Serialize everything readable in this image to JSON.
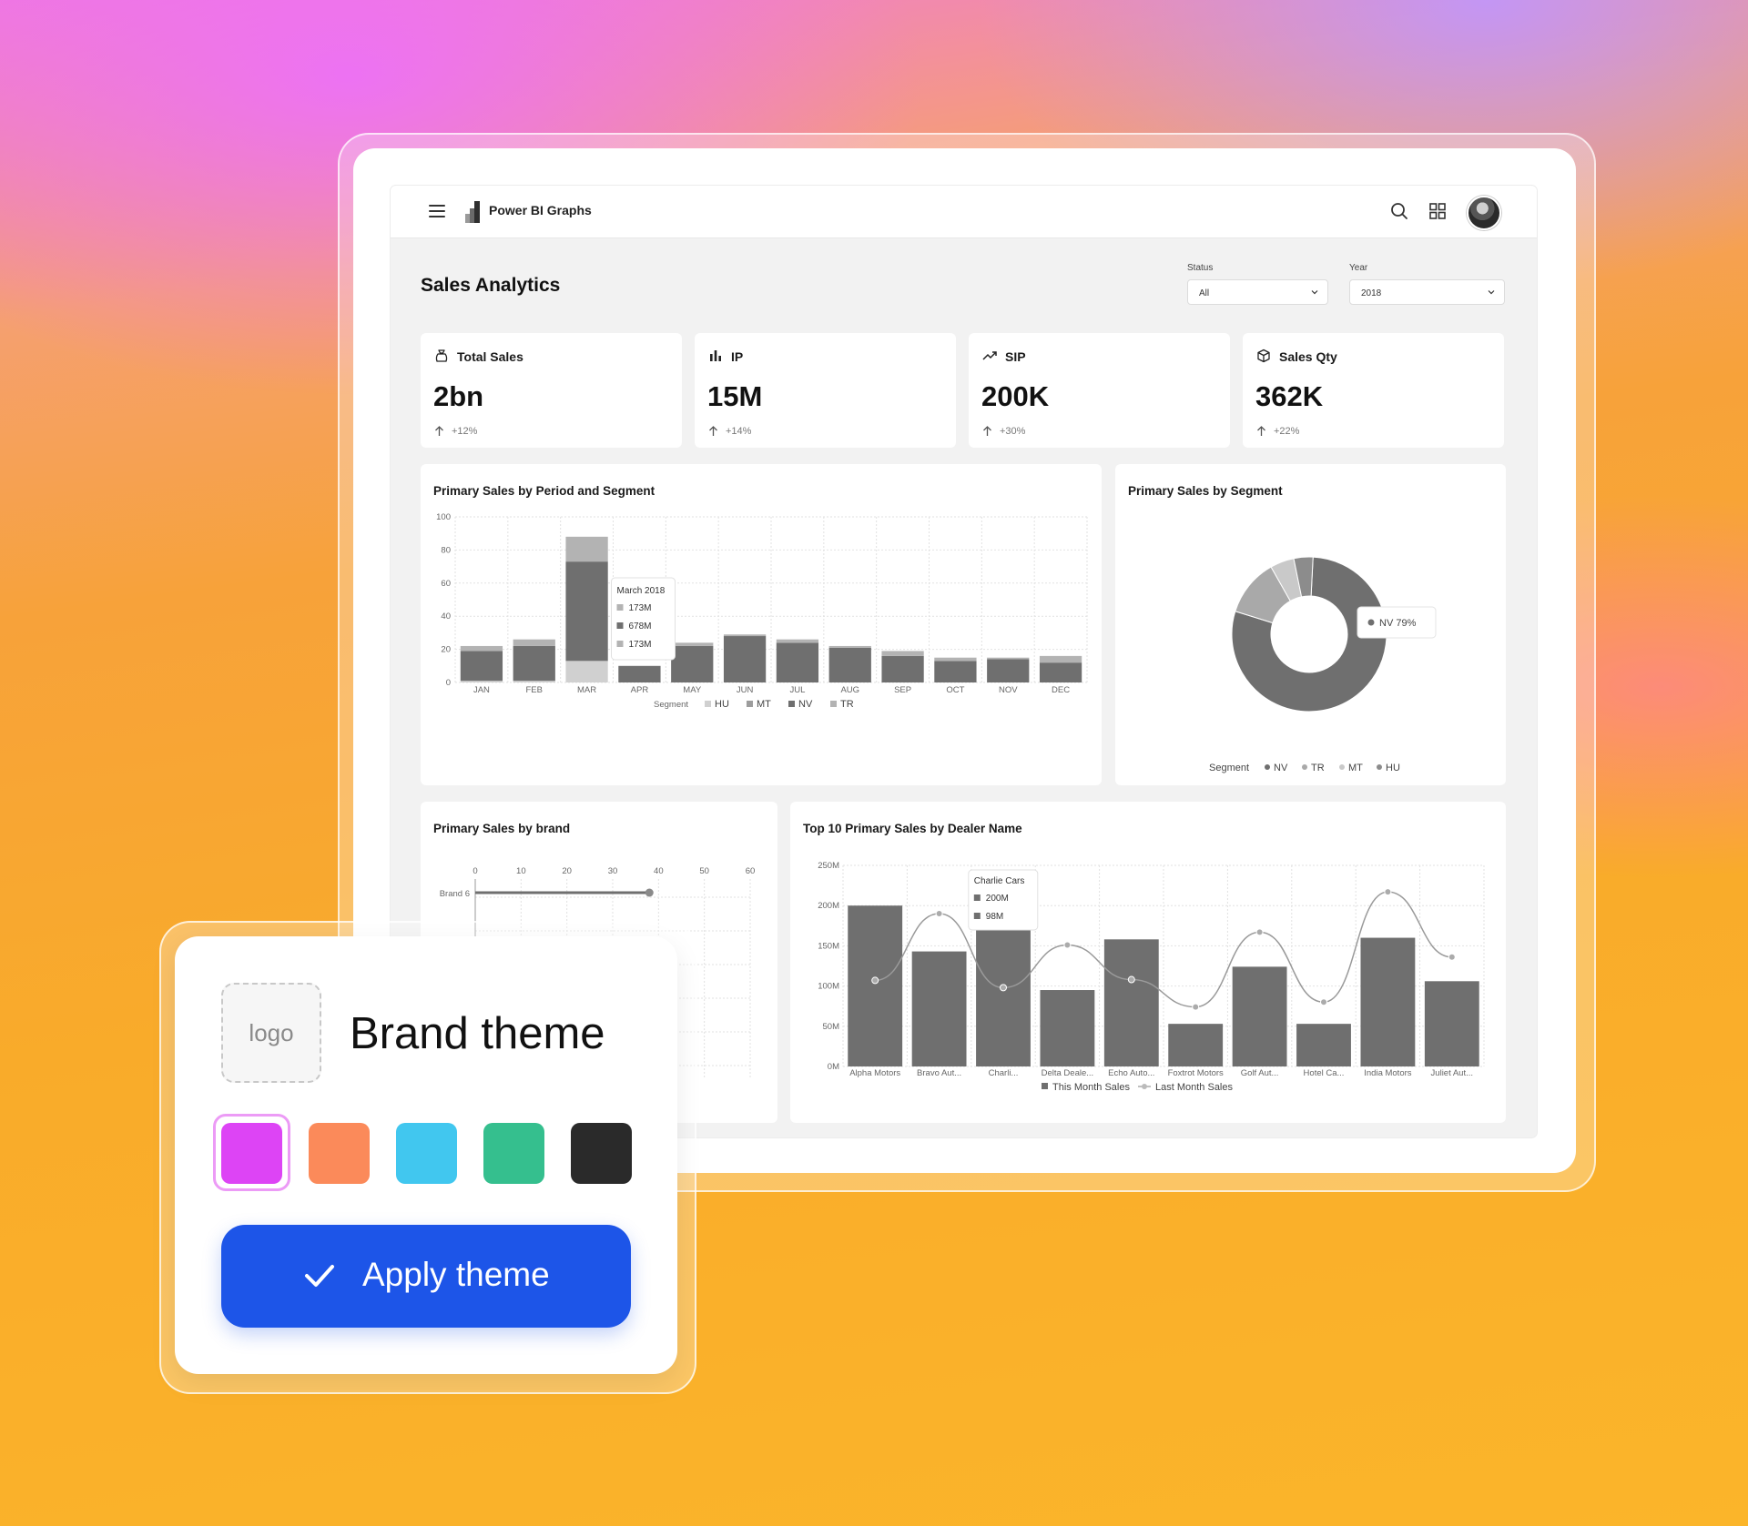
{
  "app": {
    "name": "Power BI Graphs",
    "page_title": "Sales Analytics"
  },
  "filters": {
    "status_label": "Status",
    "status_value": "All",
    "year_label": "Year",
    "year_value": "2018"
  },
  "kpis": [
    {
      "title": "Total Sales",
      "value": "2bn",
      "delta": "+12%",
      "icon": "money-bag-icon"
    },
    {
      "title": "IP",
      "value": "15M",
      "delta": "+14%",
      "icon": "bar-chart-icon"
    },
    {
      "title": "SIP",
      "value": "200K",
      "delta": "+30%",
      "icon": "trend-line-icon"
    },
    {
      "title": "Sales Qty",
      "value": "362K",
      "delta": "+22%",
      "icon": "package-icon"
    }
  ],
  "charts": {
    "period_title": "Primary Sales by Period and Segment",
    "segment_title": "Primary Sales by Segment",
    "brand_title": "Primary Sales by brand",
    "dealer_title": "Top 10 Primary Sales by Dealer Name"
  },
  "chart_data": [
    {
      "type": "bar",
      "stacked": true,
      "title": "Primary Sales by Period and Segment",
      "categories": [
        "JAN",
        "FEB",
        "MAR",
        "APR",
        "MAY",
        "JUN",
        "JUL",
        "AUG",
        "SEP",
        "OCT",
        "NOV",
        "DEC"
      ],
      "ylim": [
        0,
        100
      ],
      "yticks": [
        0,
        20,
        40,
        60,
        80,
        100
      ],
      "legend_title": "Segment",
      "series": [
        {
          "name": "HU",
          "values": [
            1,
            1,
            13,
            0,
            0,
            0,
            0,
            0,
            0,
            0,
            0,
            0
          ]
        },
        {
          "name": "MT",
          "values": [
            0,
            0,
            0,
            0,
            0,
            0,
            0,
            0,
            0,
            0,
            0,
            0
          ]
        },
        {
          "name": "NV",
          "values": [
            18,
            21,
            60,
            10,
            22,
            28,
            24,
            21,
            16,
            13,
            14,
            12
          ]
        },
        {
          "name": "TR",
          "values": [
            3,
            4,
            15,
            0,
            2,
            1,
            2,
            1,
            3,
            2,
            1,
            4
          ]
        }
      ],
      "tooltip": {
        "title": "March 2018",
        "lines": [
          "173M",
          "678M",
          "173M"
        ]
      },
      "grid": true,
      "legend_position": "bottom"
    },
    {
      "type": "pie",
      "donut": true,
      "title": "Primary Sales by Segment",
      "legend_title": "Segment",
      "categories": [
        "NV",
        "TR",
        "MT",
        "HU"
      ],
      "values": [
        79,
        12,
        5,
        4
      ],
      "tooltip": "NV 79%",
      "legend_position": "bottom"
    },
    {
      "type": "bar",
      "orientation": "horizontal",
      "title": "Primary Sales by brand",
      "xticks": [
        0,
        10,
        20,
        30,
        40,
        50,
        60
      ],
      "categories": [
        "Brand 6"
      ],
      "values": [
        38
      ],
      "grid": true
    },
    {
      "type": "bar",
      "title": "Top 10 Primary Sales by Dealer Name",
      "categories": [
        "Alpha Motors",
        "Bravo Aut...",
        "Charli...",
        "Delta Deale...",
        "Echo Auto...",
        "Foxtrot Motors",
        "Golf Aut...",
        "Hotel Ca...",
        "India Motors",
        "Juliet Aut..."
      ],
      "ylim": [
        0,
        250
      ],
      "yticks": [
        "0M",
        "50M",
        "100M",
        "150M",
        "200M",
        "250M"
      ],
      "series": [
        {
          "name": "This Month Sales",
          "type": "bar",
          "values": [
            200,
            143,
            200,
            95,
            158,
            53,
            124,
            53,
            160,
            106
          ]
        },
        {
          "name": "Last Month Sales",
          "type": "line",
          "values": [
            107,
            190,
            98,
            151,
            108,
            74,
            167,
            80,
            217,
            136
          ]
        }
      ],
      "tooltip": {
        "title": "Charlie Cars",
        "lines": [
          "200M",
          "98M"
        ]
      },
      "grid": true,
      "legend_position": "bottom"
    }
  ],
  "brand_panel": {
    "logo_label": "logo",
    "title": "Brand theme",
    "swatches": [
      "#dd44f5",
      "#fb8a5a",
      "#41c7ef",
      "#35bf8e",
      "#2a2a2a"
    ],
    "selected_swatch": 0,
    "apply_label": "Apply theme"
  },
  "colors": {
    "bar_dark": "#6f6f6f",
    "bar_light": "#b3b3b3",
    "accent_button": "#1d55e8"
  }
}
